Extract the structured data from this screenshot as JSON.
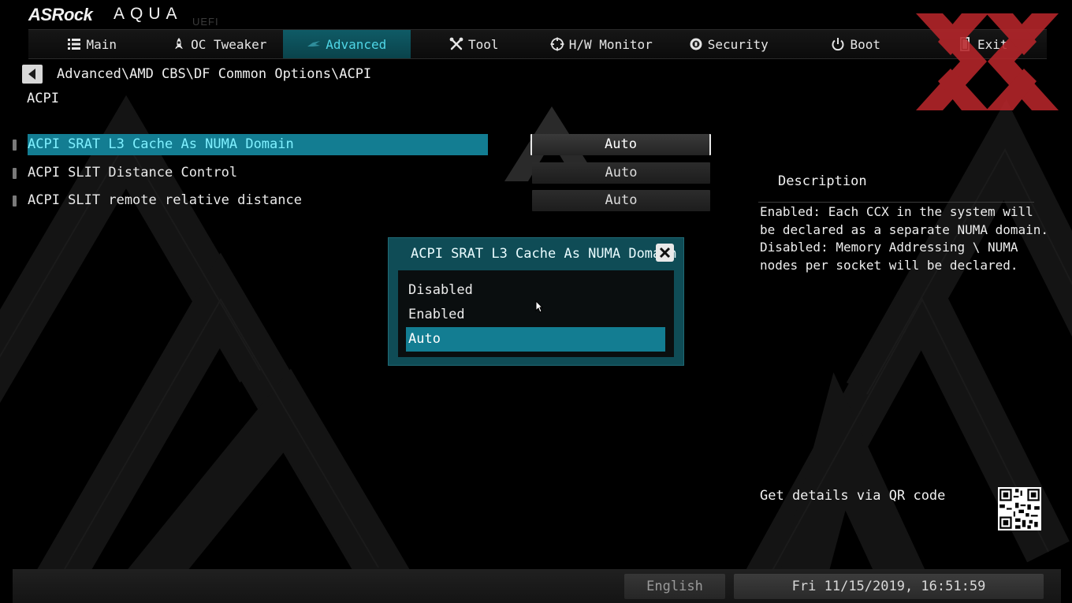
{
  "brand": {
    "name": "ASRock",
    "product": "AQUA",
    "suffix": "UEFI"
  },
  "nav": {
    "tabs": [
      {
        "label": "Main",
        "icon": "list-icon",
        "active": false
      },
      {
        "label": "OC Tweaker",
        "icon": "rocket-icon",
        "active": false
      },
      {
        "label": "Advanced",
        "icon": "advanced-icon",
        "active": true
      },
      {
        "label": "Tool",
        "icon": "tools-icon",
        "active": false
      },
      {
        "label": "H/W Monitor",
        "icon": "monitor-target-icon",
        "active": false
      },
      {
        "label": "Security",
        "icon": "shield-icon",
        "active": false
      },
      {
        "label": "Boot",
        "icon": "power-icon",
        "active": false
      },
      {
        "label": "Exit",
        "icon": "exit-icon",
        "active": false
      }
    ]
  },
  "breadcrumb": "Advanced\\AMD CBS\\DF Common Options\\ACPI",
  "page_title": "ACPI",
  "settings": [
    {
      "label": "ACPI SRAT L3 Cache As NUMA Domain",
      "value": "Auto",
      "selected": true
    },
    {
      "label": "ACPI SLIT Distance Control",
      "value": "Auto",
      "selected": false
    },
    {
      "label": "ACPI SLIT remote relative distance",
      "value": "Auto",
      "selected": false
    }
  ],
  "description": {
    "title": "Description",
    "text": "Enabled: Each CCX in the system will\nbe declared as a separate NUMA domain.\nDisabled: Memory Addressing \\ NUMA\nnodes per socket will be declared."
  },
  "qr": {
    "label": "Get details via QR code"
  },
  "popup": {
    "title": "ACPI SRAT L3 Cache As NUMA Domain",
    "options": [
      "Disabled",
      "Enabled",
      "Auto"
    ],
    "selected": "Auto"
  },
  "footer": {
    "language": "English",
    "datetime": "Fri 11/15/2019, 16:51:59"
  },
  "colors": {
    "accent": "#137d92",
    "accent_text": "#4fd6e6",
    "popup_bg": "#0f4c56",
    "logo_red": "#c0282d"
  }
}
